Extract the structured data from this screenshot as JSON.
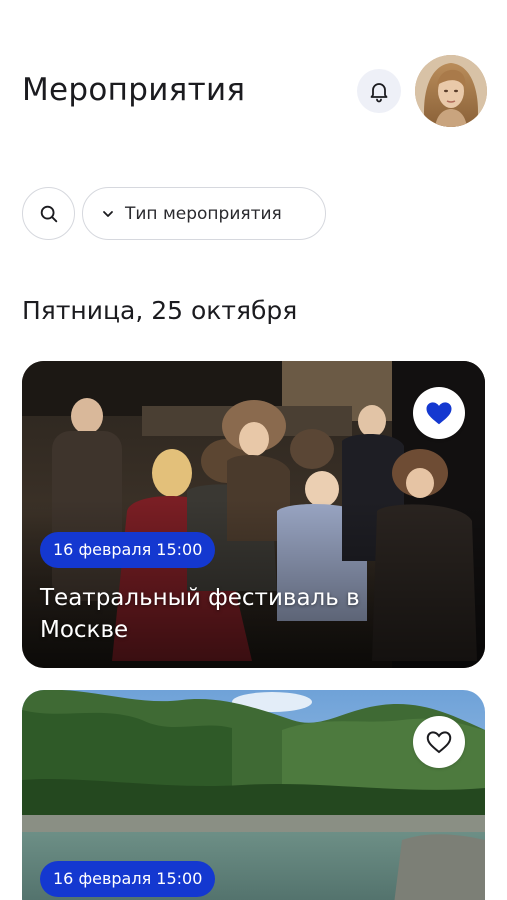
{
  "header": {
    "title": "Мероприятия"
  },
  "filters": {
    "type_label": "Тип мероприятия"
  },
  "section": {
    "day_heading": "Пятница, 25 октября"
  },
  "events": [
    {
      "date": "16 февраля 15:00",
      "title": "Театральный фестиваль в Москве",
      "favorite": true
    },
    {
      "date": "16 февраля 15:00",
      "favorite": false
    }
  ],
  "colors": {
    "accent": "#1438d0",
    "favorite_active": "#1438d0",
    "bell_bg": "#eef0f7"
  },
  "icons": {
    "bell": "bell-icon",
    "search": "search-icon",
    "chevron": "chevron-down-icon",
    "heart_filled": "heart-filled-icon",
    "heart_outline": "heart-outline-icon"
  }
}
